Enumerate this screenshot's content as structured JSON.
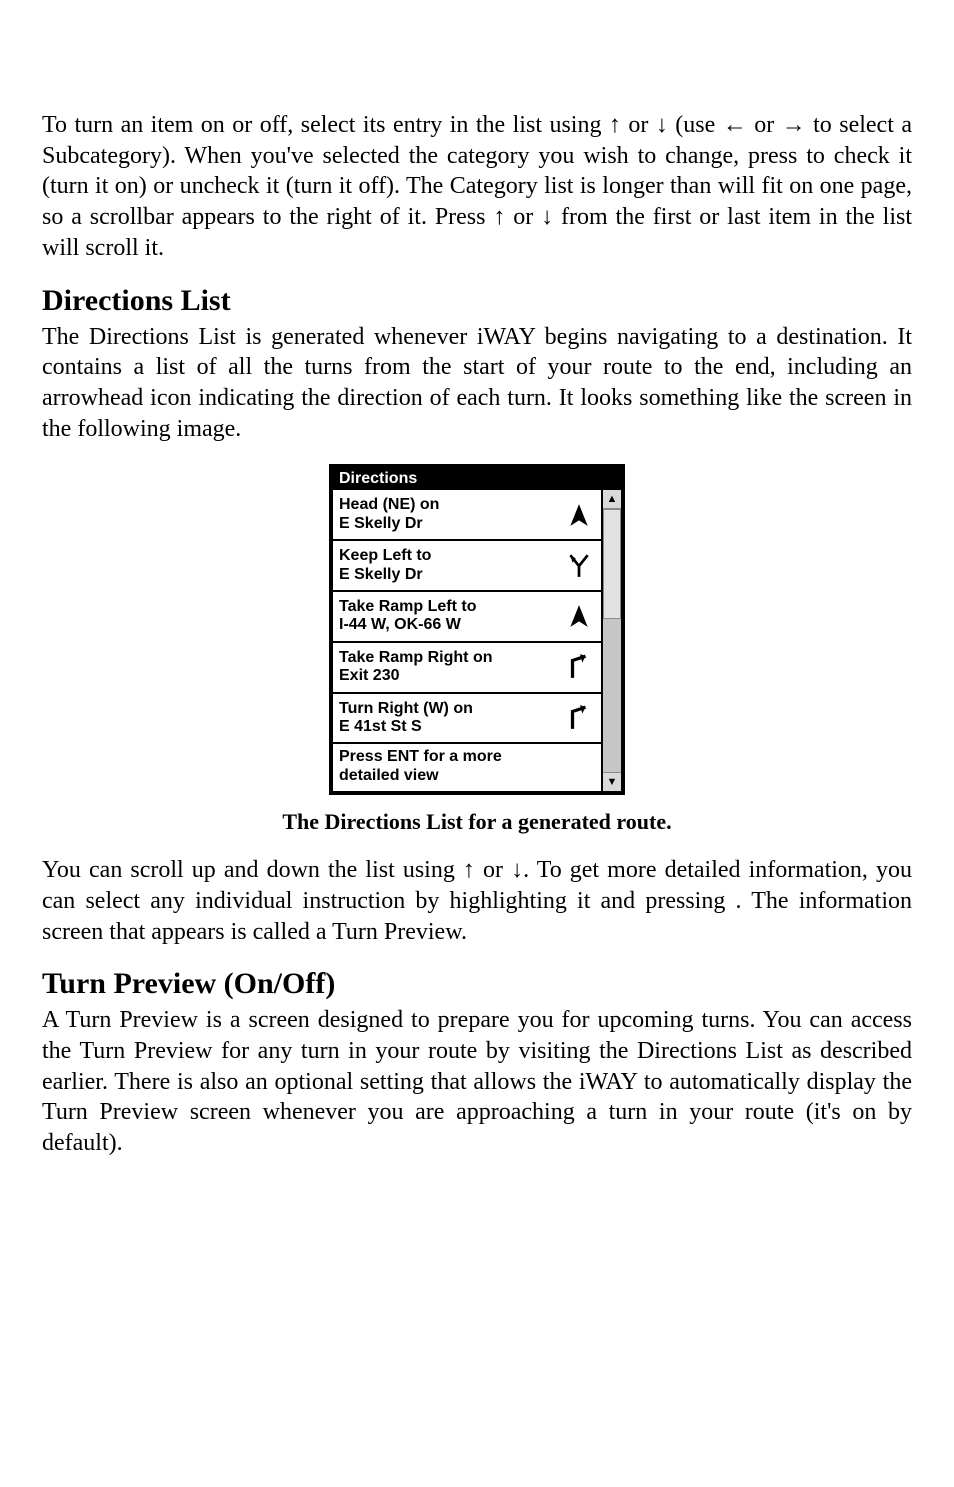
{
  "paragraphs": {
    "p1": "To turn an item on or off, select its entry in the list using ↑ or ↓ (use ← or → to select a Subcategory). When you've selected the category you wish to change, press          to check it (turn it on) or uncheck it (turn it off). The Category list is longer than will fit on one page, so a scrollbar appears to the right of it. Press ↑ or ↓ from the first or last item in the list will scroll it.",
    "h1": "Directions List",
    "p2": "The Directions List is generated whenever iWAY begins navigating to a destination. It contains a list of all the turns from the start of your route to the end, including an arrowhead icon indicating the direction of each turn. It looks something like the screen in the following image.",
    "caption": "The Directions List for a generated route.",
    "p3": "You can scroll up and down the list using ↑ or ↓. To get more detailed information, you can select any individual instruction by highlighting it and pressing        . The information screen that appears is called a Turn Preview.",
    "h2": "Turn Preview (On/Off)",
    "p4": "A Turn Preview is a screen designed to prepare you for upcoming turns. You can access the Turn Preview for any turn in your route by visiting the Directions List as described earlier. There is also an optional setting that allows the iWAY to automatically display the Turn Preview screen whenever you are approaching a turn in your route (it's on by default)."
  },
  "screenshot": {
    "title": "Directions",
    "items": [
      {
        "text_l1": "Head (NE) on",
        "text_l2": "E Skelly Dr",
        "icon": "north"
      },
      {
        "text_l1": "Keep Left to",
        "text_l2": "E Skelly Dr",
        "icon": "fork-left"
      },
      {
        "text_l1": "Take Ramp Left to",
        "text_l2": "I-44 W, OK-66 W",
        "icon": "north"
      },
      {
        "text_l1": "Take Ramp Right on",
        "text_l2": "Exit 230",
        "icon": "ramp-right"
      },
      {
        "text_l1": "Turn Right (W) on",
        "text_l2": "E 41st St S",
        "icon": "ramp-right"
      }
    ],
    "footer_l1": "Press ENT for a more",
    "footer_l2": "detailed view"
  }
}
